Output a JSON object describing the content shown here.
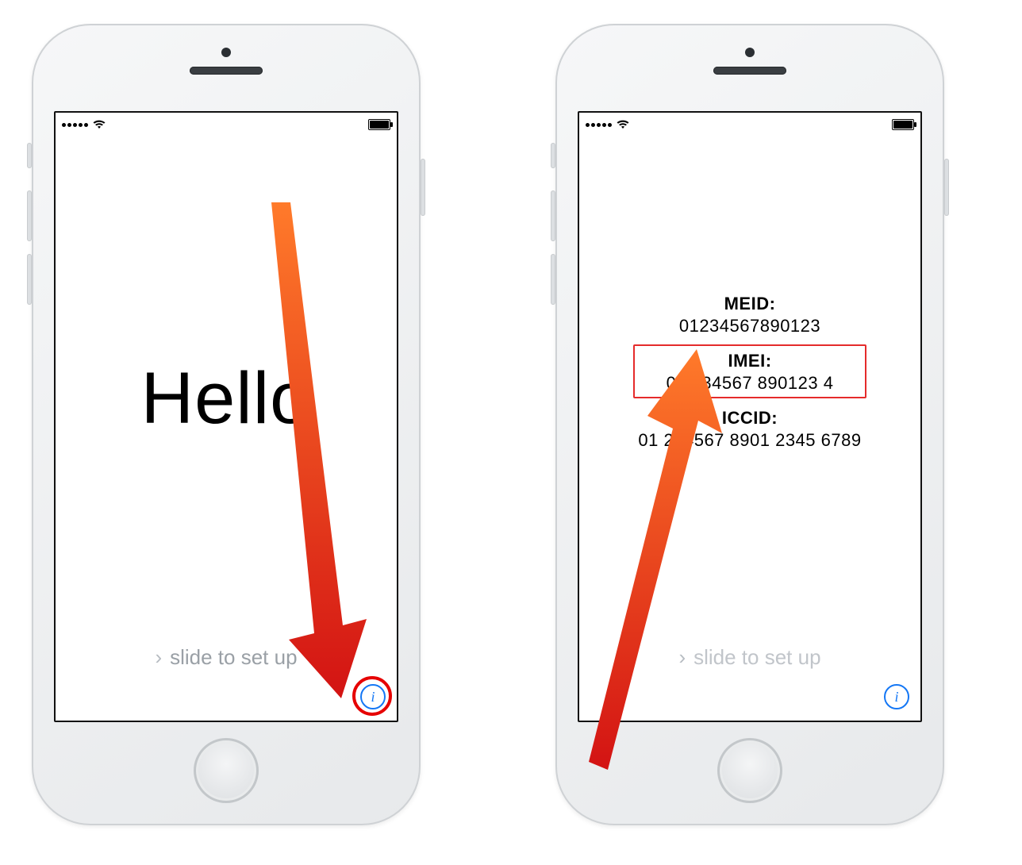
{
  "colors": {
    "highlight": "#e60000",
    "accent_blue": "#1477f5"
  },
  "status": {
    "signal_dots": 5,
    "wifi": true,
    "battery_full": true
  },
  "left_phone": {
    "greeting": "Hello",
    "slide_prompt": "slide to set up",
    "info_glyph": "i"
  },
  "right_phone": {
    "slide_prompt": "slide to set up",
    "info_glyph": "i",
    "device_info": {
      "meid_label": "MEID:",
      "meid_value": "01234567890123",
      "imei_label": "IMEI:",
      "imei_value": "01 234567 890123 4",
      "iccid_label": "ICCID:",
      "iccid_value": "01 234567 8901 2345 6789"
    }
  }
}
